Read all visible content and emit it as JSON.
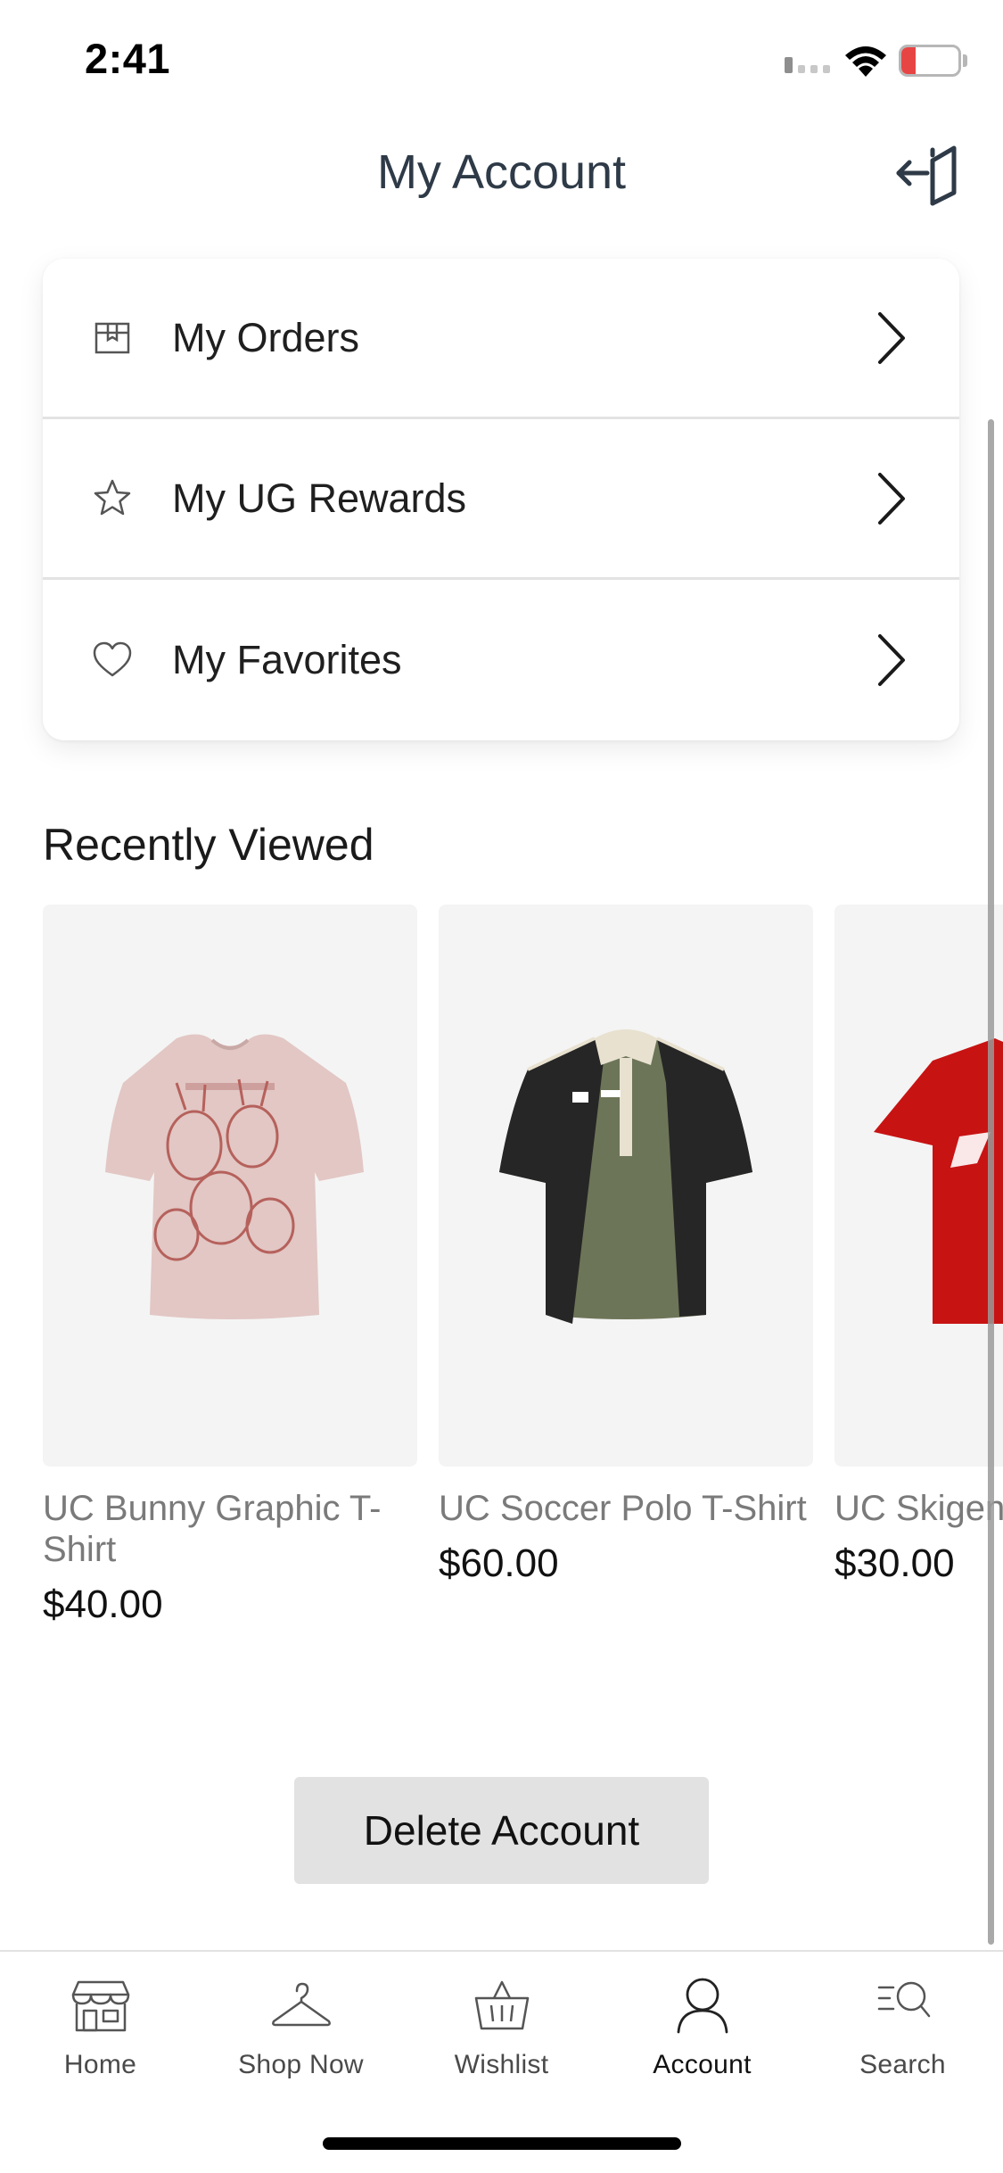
{
  "status_bar": {
    "time": "2:41",
    "battery": "11",
    "battery_level": 0.11,
    "battery_color": "#e74544"
  },
  "header": {
    "title": "My Account",
    "logout_icon": "logout-icon"
  },
  "menu": [
    {
      "label": "My Orders",
      "icon": "box-icon"
    },
    {
      "label": "My UG Rewards",
      "icon": "star-icon"
    },
    {
      "label": "My Favorites",
      "icon": "heart-icon"
    }
  ],
  "recently_viewed": {
    "title": "Recently Viewed",
    "products": [
      {
        "name": "UC Bunny Graphic T-Shirt",
        "price": "$40.00",
        "color": "#e2c7c4"
      },
      {
        "name": "UC Soccer Polo T-Shirt",
        "price": "$60.00",
        "color": "#6d7558"
      },
      {
        "name": "UC Skigen",
        "price": "$30.00",
        "color": "#c81313"
      }
    ]
  },
  "actions": {
    "delete_account": "Delete Account"
  },
  "tabbar": {
    "items": [
      {
        "label": "Home",
        "icon": "storefront-icon"
      },
      {
        "label": "Shop Now",
        "icon": "hanger-icon"
      },
      {
        "label": "Wishlist",
        "icon": "basket-icon"
      },
      {
        "label": "Account",
        "icon": "person-icon",
        "active": true
      },
      {
        "label": "Search",
        "icon": "search-list-icon"
      }
    ]
  }
}
